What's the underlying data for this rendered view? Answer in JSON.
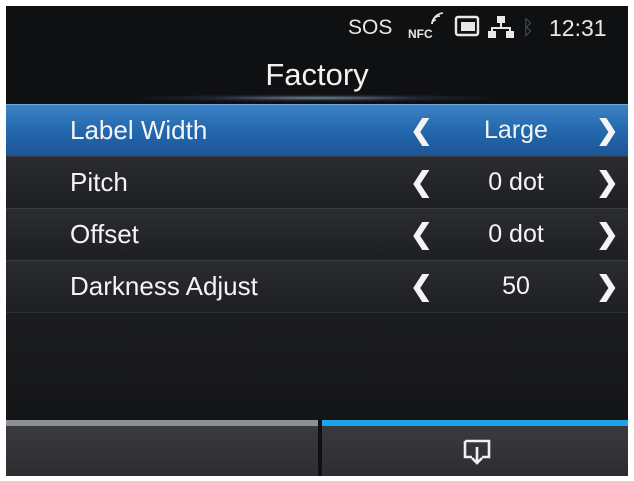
{
  "status_bar": {
    "sos": "SOS",
    "nfc": "NFC",
    "card_icon": "sd-card-icon",
    "network_icon": "lan-network-icon",
    "bluetooth_icon": "bluetooth-icon",
    "time": "12:31"
  },
  "title": "Factory",
  "menu": {
    "items": [
      {
        "label": "Label Width",
        "value": "Large"
      },
      {
        "label": "Pitch",
        "value": "0 dot"
      },
      {
        "label": "Offset",
        "value": "0 dot"
      },
      {
        "label": "Darkness Adjust",
        "value": "50"
      }
    ],
    "selected_index": 0,
    "left_arrow": "❮",
    "right_arrow": "❯"
  },
  "tabs": {
    "right_icon": "print-feed-icon"
  },
  "colors": {
    "selected_row": "#2a6fb5",
    "active_tab_indicator": "#1ea3e8",
    "inactive_tab_indicator": "#8e8f93"
  }
}
